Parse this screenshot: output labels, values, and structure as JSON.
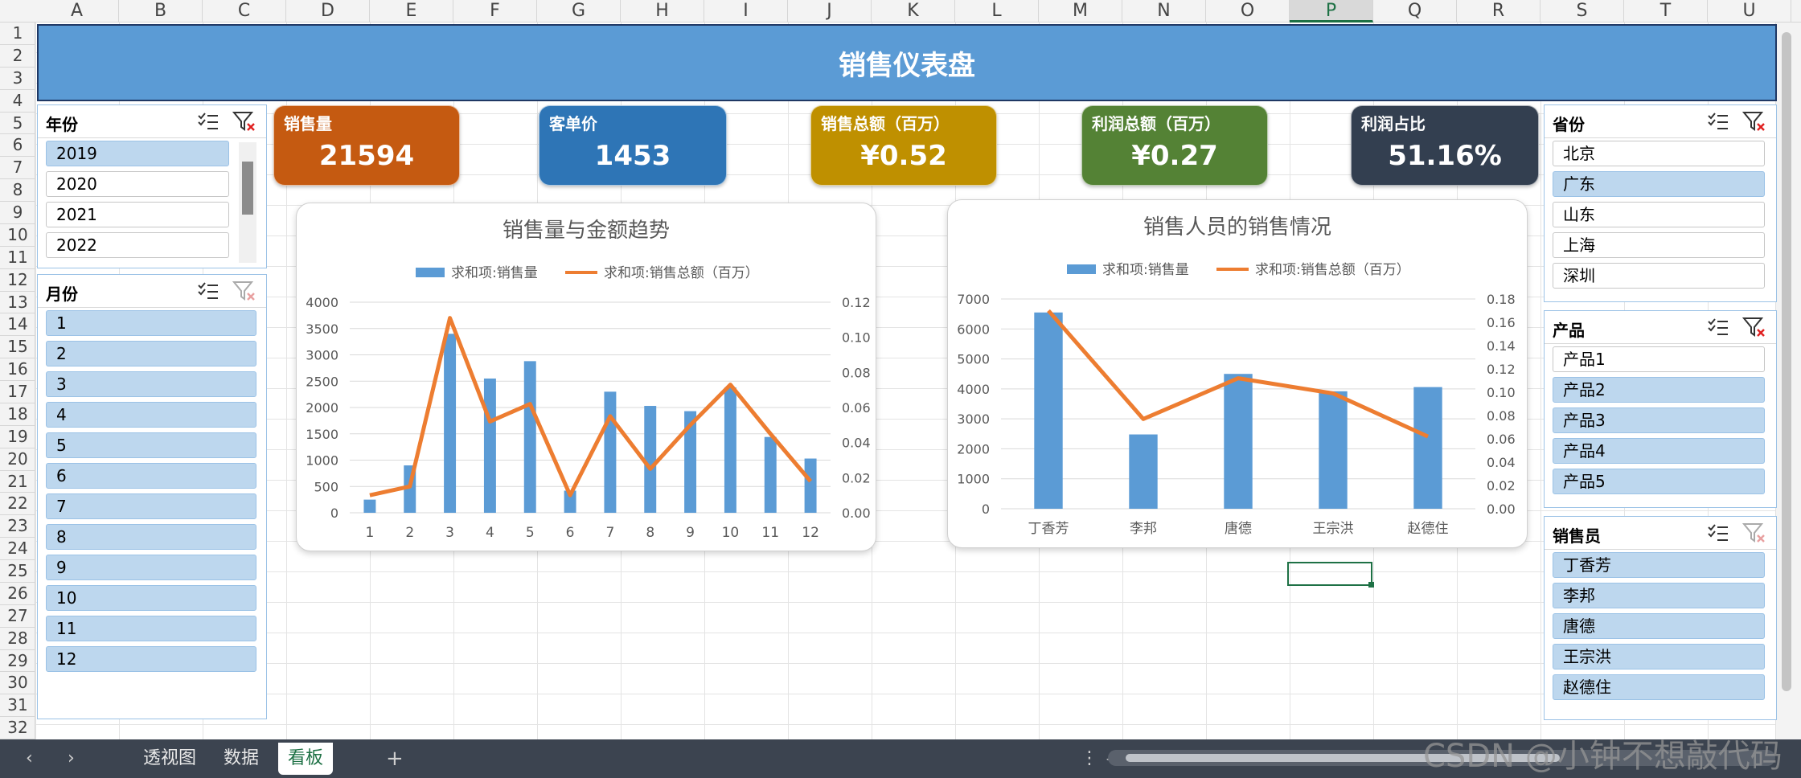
{
  "columns": [
    "A",
    "B",
    "C",
    "D",
    "E",
    "F",
    "G",
    "H",
    "I",
    "J",
    "K",
    "L",
    "M",
    "N",
    "O",
    "P",
    "Q",
    "R",
    "S",
    "T",
    "U"
  ],
  "selected_column": "P",
  "rows": [
    "1",
    "2",
    "3",
    "4",
    "5",
    "6",
    "7",
    "8",
    "9",
    "10",
    "11",
    "12",
    "13",
    "14",
    "15",
    "16",
    "17",
    "18",
    "19",
    "20",
    "21",
    "22",
    "23",
    "24",
    "25",
    "26",
    "27",
    "28",
    "29",
    "30",
    "31",
    "32"
  ],
  "banner": {
    "title": "销售仪表盘"
  },
  "kpis": [
    {
      "label": "销售量",
      "value": "21594",
      "color": "#c55a11"
    },
    {
      "label": "客单价",
      "value": "1453",
      "color": "#2e75b6"
    },
    {
      "label": "销售总额（百万）",
      "value": "¥0.52",
      "color": "#bf9000"
    },
    {
      "label": "利润总额（百万）",
      "value": "¥0.27",
      "color": "#548235"
    },
    {
      "label": "利润占比",
      "value": "51.16%",
      "color": "#333f50"
    }
  ],
  "slicers": {
    "year": {
      "title": "年份",
      "items": [
        {
          "label": "2019",
          "selected": true
        },
        {
          "label": "2020",
          "selected": false
        },
        {
          "label": "2021",
          "selected": false
        },
        {
          "label": "2022",
          "selected": false
        }
      ]
    },
    "month": {
      "title": "月份",
      "items": [
        {
          "label": "1",
          "selected": true
        },
        {
          "label": "2",
          "selected": true
        },
        {
          "label": "3",
          "selected": true
        },
        {
          "label": "4",
          "selected": true
        },
        {
          "label": "5",
          "selected": true
        },
        {
          "label": "6",
          "selected": true
        },
        {
          "label": "7",
          "selected": true
        },
        {
          "label": "8",
          "selected": true
        },
        {
          "label": "9",
          "selected": true
        },
        {
          "label": "10",
          "selected": true
        },
        {
          "label": "11",
          "selected": true
        },
        {
          "label": "12",
          "selected": true
        }
      ]
    },
    "province": {
      "title": "省份",
      "items": [
        {
          "label": "北京",
          "selected": false
        },
        {
          "label": "广东",
          "selected": true
        },
        {
          "label": "山东",
          "selected": false
        },
        {
          "label": "上海",
          "selected": false
        },
        {
          "label": "深圳",
          "selected": false
        }
      ]
    },
    "product": {
      "title": "产品",
      "items": [
        {
          "label": "产品1",
          "selected": false
        },
        {
          "label": "产品2",
          "selected": true
        },
        {
          "label": "产品3",
          "selected": true
        },
        {
          "label": "产品4",
          "selected": true
        },
        {
          "label": "产品5",
          "selected": true
        }
      ]
    },
    "salesperson": {
      "title": "销售员",
      "items": [
        {
          "label": "丁香芳",
          "selected": true
        },
        {
          "label": "李邦",
          "selected": true
        },
        {
          "label": "唐德",
          "selected": true
        },
        {
          "label": "王宗洪",
          "selected": true
        },
        {
          "label": "赵德住",
          "selected": true
        }
      ]
    }
  },
  "chart_data": [
    {
      "type": "bar",
      "title": "销售量与金额趋势",
      "categories": [
        "1",
        "2",
        "3",
        "4",
        "5",
        "6",
        "7",
        "8",
        "9",
        "10",
        "11",
        "12"
      ],
      "series": [
        {
          "name": "求和项:销售量",
          "type": "bar",
          "axis": "left",
          "values": [
            250,
            900,
            3400,
            2550,
            2880,
            420,
            2300,
            2030,
            1930,
            2380,
            1440,
            1030
          ]
        },
        {
          "name": "求和项:销售总额（百万）",
          "type": "line",
          "axis": "right",
          "values": [
            0.01,
            0.015,
            0.111,
            0.052,
            0.062,
            0.01,
            0.055,
            0.025,
            0.05,
            0.073,
            0.045,
            0.018
          ]
        }
      ],
      "ylim": [
        0,
        4000
      ],
      "y_ticks": [
        "0",
        "500",
        "1000",
        "1500",
        "2000",
        "2500",
        "3000",
        "3500",
        "4000"
      ],
      "y2lim": [
        0,
        0.12
      ],
      "y2_ticks": [
        "0.00",
        "0.02",
        "0.04",
        "0.06",
        "0.08",
        "0.10",
        "0.12"
      ],
      "legend": "top",
      "grid": true,
      "bar_color": "#5b9bd5",
      "line_color": "#ed7d31"
    },
    {
      "type": "bar",
      "title": "销售人员的销售情况",
      "categories": [
        "丁香芳",
        "李邦",
        "唐德",
        "王宗洪",
        "赵德住"
      ],
      "series": [
        {
          "name": "求和项:销售量",
          "type": "bar",
          "axis": "left",
          "values": [
            6550,
            2480,
            4500,
            3920,
            4060
          ]
        },
        {
          "name": "求和项:销售总额（百万）",
          "type": "line",
          "axis": "right",
          "values": [
            0.17,
            0.077,
            0.112,
            0.099,
            0.062
          ]
        }
      ],
      "ylim": [
        0,
        7000
      ],
      "y_ticks": [
        "0",
        "1000",
        "2000",
        "3000",
        "4000",
        "5000",
        "6000",
        "7000"
      ],
      "y2lim": [
        0,
        0.18
      ],
      "y2_ticks": [
        "0.00",
        "0.02",
        "0.04",
        "0.06",
        "0.08",
        "0.10",
        "0.12",
        "0.14",
        "0.16",
        "0.18"
      ],
      "legend": "top",
      "grid": true,
      "bar_color": "#5b9bd5",
      "line_color": "#ed7d31"
    }
  ],
  "tabs": [
    {
      "label": "透视图",
      "active": false
    },
    {
      "label": "数据",
      "active": false
    },
    {
      "label": "看板",
      "active": true
    }
  ],
  "add_sheet": "+",
  "nav": {
    "prev": "‹",
    "next": "›",
    "more": "⋮",
    "scroll_left": "◀"
  },
  "watermark": "CSDN @小钟不想敲代码"
}
